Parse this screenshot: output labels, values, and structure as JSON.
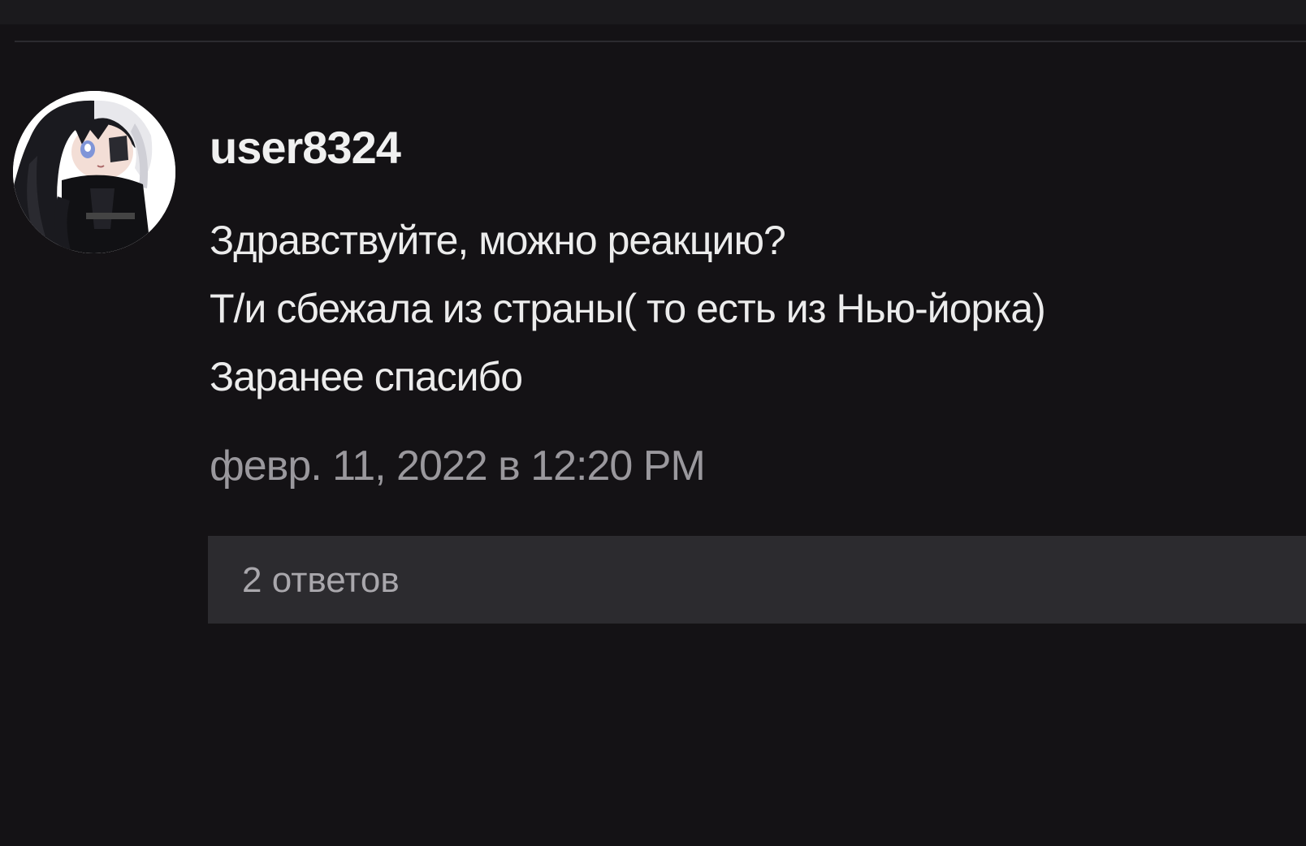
{
  "comment": {
    "username": "user8324",
    "avatar_icon": "anime-character-avatar",
    "message_lines": [
      "Здравствуйте, можно реакцию?",
      "Т/и сбежала из страны( то есть из Нью-йорка)",
      "Заранее спасибо"
    ],
    "timestamp": "февр. 11, 2022 в 12:20 PM",
    "replies_label": "2 ответов"
  },
  "colors": {
    "background": "#141215",
    "divider": "#2c2b2f",
    "replies_bar": "#2c2b2f",
    "text_primary": "#ececec",
    "text_secondary": "#9a989d"
  }
}
